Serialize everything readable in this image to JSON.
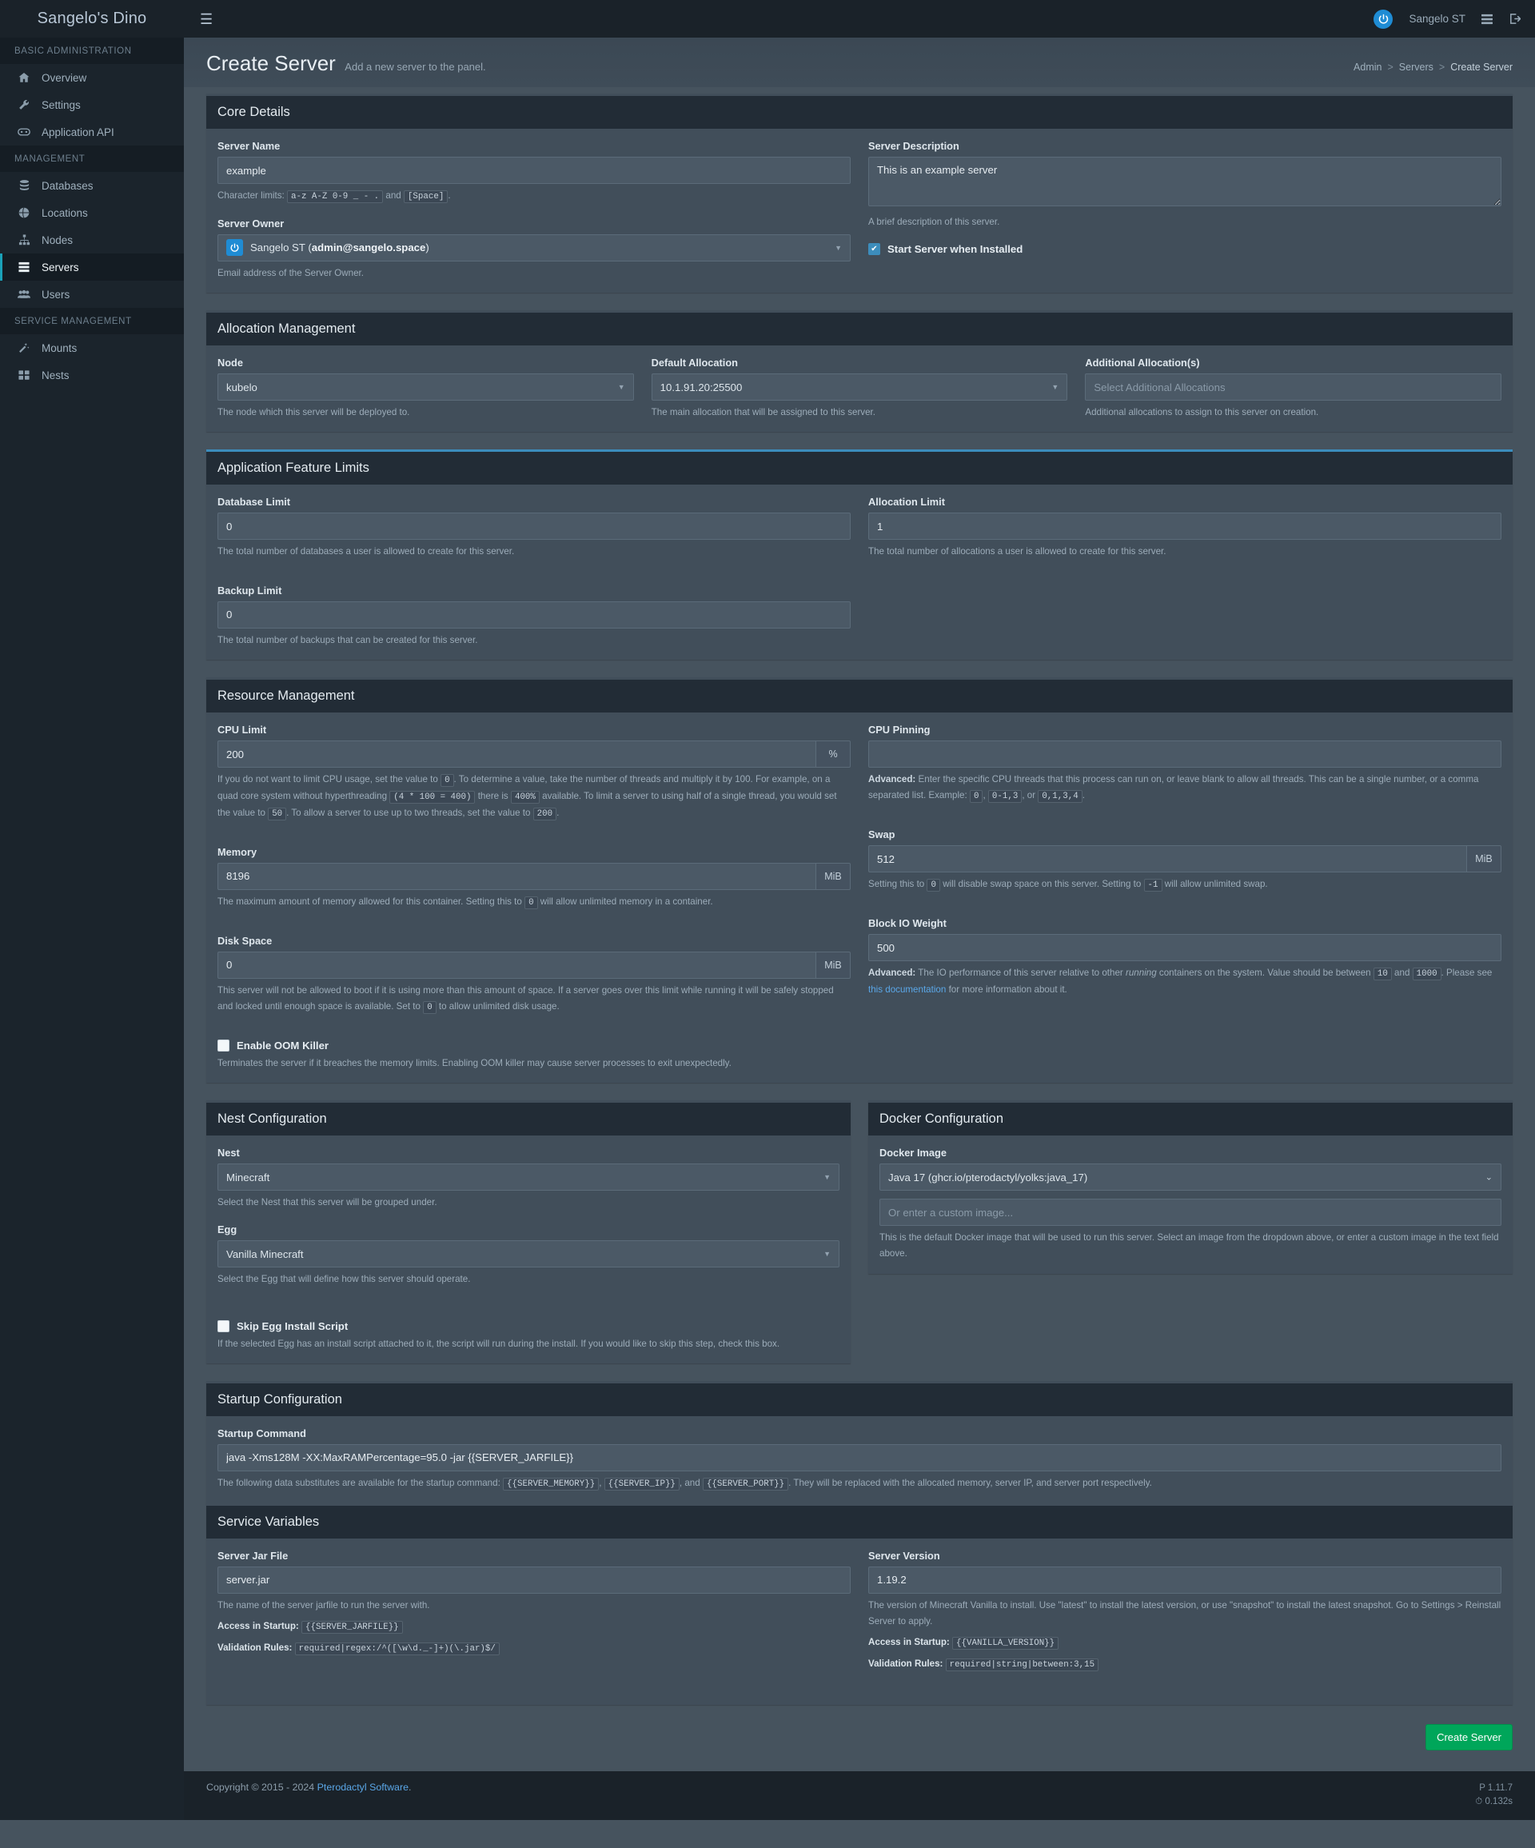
{
  "app": {
    "brand": "Sangelo's Dino",
    "user_name": "Sangelo ST",
    "menu_icon": "hamburger-icon",
    "list_icon": "server-list-icon",
    "logout_icon": "logout-icon"
  },
  "sidebar": {
    "groups": [
      {
        "title": "BASIC ADMINISTRATION",
        "items": [
          {
            "label": "Overview",
            "icon": "home-icon",
            "active": false
          },
          {
            "label": "Settings",
            "icon": "wrench-icon",
            "active": false
          },
          {
            "label": "Application API",
            "icon": "link-icon",
            "active": false
          }
        ]
      },
      {
        "title": "MANAGEMENT",
        "items": [
          {
            "label": "Databases",
            "icon": "database-icon",
            "active": false
          },
          {
            "label": "Locations",
            "icon": "globe-icon",
            "active": false
          },
          {
            "label": "Nodes",
            "icon": "sitemap-icon",
            "active": false
          },
          {
            "label": "Servers",
            "icon": "server-icon",
            "active": true
          },
          {
            "label": "Users",
            "icon": "users-icon",
            "active": false
          }
        ]
      },
      {
        "title": "SERVICE MANAGEMENT",
        "items": [
          {
            "label": "Mounts",
            "icon": "magic-wand-icon",
            "active": false
          },
          {
            "label": "Nests",
            "icon": "grid-icon",
            "active": false
          }
        ]
      }
    ]
  },
  "header": {
    "title": "Create Server",
    "subtitle": "Add a new server to the panel.",
    "breadcrumb": [
      "Admin",
      "Servers",
      "Create Server"
    ],
    "breadcrumb_separator": ">"
  },
  "core_details": {
    "title": "Core Details",
    "server_name": {
      "label": "Server Name",
      "value": "example",
      "help_prefix": "Character limits:",
      "help_code_1": "a-z A-Z 0-9 _ - .",
      "help_mid": "and",
      "help_code_2": "[Space]",
      "help_suffix": "."
    },
    "server_owner": {
      "label": "Server Owner",
      "value_name": "Sangelo ST",
      "value_email": "admin@sangelo.space",
      "help": "Email address of the Server Owner."
    },
    "server_description": {
      "label": "Server Description",
      "value": "This is an example server",
      "help": "A brief description of this server."
    },
    "start_when_installed": {
      "label": "Start Server when Installed",
      "checked": true
    }
  },
  "allocation_management": {
    "title": "Allocation Management",
    "node": {
      "label": "Node",
      "value": "kubelo",
      "help": "The node which this server will be deployed to."
    },
    "default_allocation": {
      "label": "Default Allocation",
      "value": "10.1.91.20:25500",
      "help": "The main allocation that will be assigned to this server."
    },
    "additional_allocations": {
      "label": "Additional Allocation(s)",
      "placeholder": "Select Additional Allocations",
      "value": "",
      "help": "Additional allocations to assign to this server on creation."
    }
  },
  "application_feature_limits": {
    "title": "Application Feature Limits",
    "database_limit": {
      "label": "Database Limit",
      "value": "0",
      "help": "The total number of databases a user is allowed to create for this server."
    },
    "allocation_limit": {
      "label": "Allocation Limit",
      "value": "1",
      "help": "The total number of allocations a user is allowed to create for this server."
    },
    "backup_limit": {
      "label": "Backup Limit",
      "value": "0",
      "help": "The total number of backups that can be created for this server."
    }
  },
  "resource_management": {
    "title": "Resource Management",
    "cpu_limit": {
      "label": "CPU Limit",
      "value": "200",
      "addon": "%",
      "help_1": "If you do not want to limit CPU usage, set the value to",
      "code_1": "0",
      "help_2": ". To determine a value, take the number of threads and multiply it by 100. For example, on a quad core system without hyperthreading",
      "code_2": "(4 * 100 = 400)",
      "help_3": "there is",
      "code_3": "400%",
      "help_4": "available. To limit a server to using half of a single thread, you would set the value to",
      "code_4": "50",
      "help_5": ". To allow a server to use up to two threads, set the value to",
      "code_5": "200",
      "help_6": "."
    },
    "cpu_pinning": {
      "label": "CPU Pinning",
      "value": "",
      "advanced_label": "Advanced:",
      "help_1": "Enter the specific CPU threads that this process can run on, or leave blank to allow all threads. This can be a single number, or a comma separated list. Example:",
      "code_1": "0",
      "help_2": ",",
      "code_2": "0-1,3",
      "help_3": ", or",
      "code_3": "0,1,3,4",
      "help_4": "."
    },
    "memory": {
      "label": "Memory",
      "value": "8196",
      "addon": "MiB",
      "help_1": "The maximum amount of memory allowed for this container. Setting this to",
      "code_1": "0",
      "help_2": "will allow unlimited memory in a container."
    },
    "swap": {
      "label": "Swap",
      "value": "512",
      "addon": "MiB",
      "help_1": "Setting this to",
      "code_1": "0",
      "help_2": "will disable swap space on this server. Setting to",
      "code_2": "-1",
      "help_3": "will allow unlimited swap."
    },
    "disk_space": {
      "label": "Disk Space",
      "value": "0",
      "addon": "MiB",
      "help_1": "This server will not be allowed to boot if it is using more than this amount of space. If a server goes over this limit while running it will be safely stopped and locked until enough space is available. Set to",
      "code_1": "0",
      "help_2": "to allow unlimited disk usage."
    },
    "block_io_weight": {
      "label": "Block IO Weight",
      "value": "500",
      "advanced_label": "Advanced:",
      "help_1": "The IO performance of this server relative to other",
      "help_italic": "running",
      "help_2": "containers on the system. Value should be between",
      "code_1": "10",
      "help_3": "and",
      "code_2": "1000",
      "help_4": ". Please see",
      "link_text": "this documentation",
      "help_5": "for more information about it."
    },
    "oom_killer": {
      "label": "Enable OOM Killer",
      "checked": false,
      "help": "Terminates the server if it breaches the memory limits. Enabling OOM killer may cause server processes to exit unexpectedly."
    }
  },
  "nest_configuration": {
    "title": "Nest Configuration",
    "nest": {
      "label": "Nest",
      "value": "Minecraft",
      "help": "Select the Nest that this server will be grouped under."
    },
    "egg": {
      "label": "Egg",
      "value": "Vanilla Minecraft",
      "help": "Select the Egg that will define how this server should operate."
    },
    "skip_egg_install": {
      "label": "Skip Egg Install Script",
      "checked": false,
      "help": "If the selected Egg has an install script attached to it, the script will run during the install. If you would like to skip this step, check this box."
    }
  },
  "docker_configuration": {
    "title": "Docker Configuration",
    "docker_image": {
      "label": "Docker Image",
      "value": "Java 17 (ghcr.io/pterodactyl/yolks:java_17)",
      "custom_placeholder": "Or enter a custom image...",
      "custom_value": "",
      "help": "This is the default Docker image that will be used to run this server. Select an image from the dropdown above, or enter a custom image in the text field above."
    }
  },
  "startup_configuration": {
    "title": "Startup Configuration",
    "startup_command": {
      "label": "Startup Command",
      "value": "java -Xms128M -XX:MaxRAMPercentage=95.0 -jar {{SERVER_JARFILE}}",
      "help_1": "The following data substitutes are available for the startup command:",
      "code_1": "{{SERVER_MEMORY}}",
      "help_2": ",",
      "code_2": "{{SERVER_IP}}",
      "help_3": ", and",
      "code_3": "{{SERVER_PORT}}",
      "help_4": ". They will be replaced with the allocated memory, server IP, and server port respectively."
    }
  },
  "service_variables": {
    "title": "Service Variables",
    "server_jar_file": {
      "label": "Server Jar File",
      "value": "server.jar",
      "help": "The name of the server jarfile to run the server with.",
      "access_label": "Access in Startup:",
      "access_code": "{{SERVER_JARFILE}}",
      "rules_label": "Validation Rules:",
      "rules_code": "required|regex:/^([\\w\\d._-]+)(\\.jar)$/"
    },
    "server_version": {
      "label": "Server Version",
      "value": "1.19.2",
      "help": "The version of Minecraft Vanilla to install. Use \"latest\" to install the latest version, or use \"snapshot\" to install the latest snapshot. Go to Settings > Reinstall Server to apply.",
      "access_label": "Access in Startup:",
      "access_code": "{{VANILLA_VERSION}}",
      "rules_label": "Validation Rules:",
      "rules_code": "required|string|between:3,15"
    }
  },
  "actions": {
    "create_server": "Create Server"
  },
  "footer": {
    "copyright_prefix": "Copyright © 2015 - 2024",
    "link": "Pterodactyl Software",
    "copyright_suffix": ".",
    "version": "1.11.7",
    "version_icon": "P",
    "load_time": "0.132s",
    "load_icon": "⏱"
  }
}
